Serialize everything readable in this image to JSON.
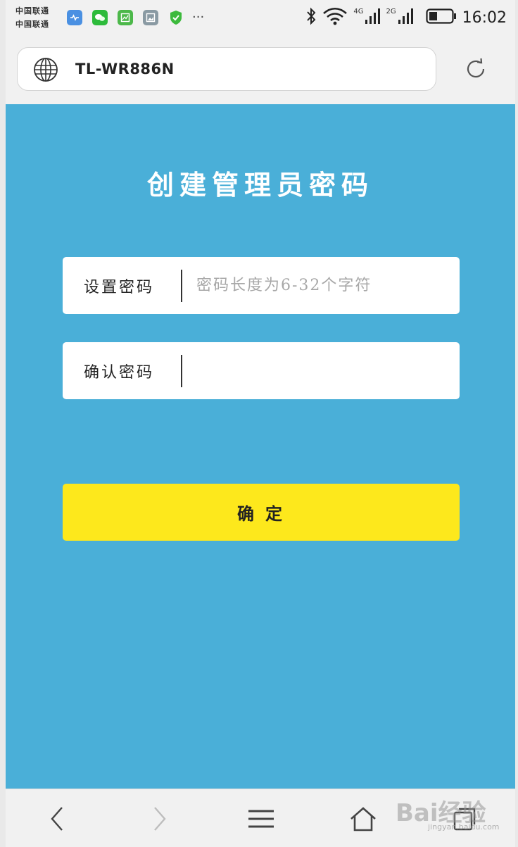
{
  "status_bar": {
    "carrier_1": "中国联通",
    "carrier_2": "中国联通",
    "more": "···",
    "net1": "4G",
    "net2": "2G",
    "time": "16:02"
  },
  "browser": {
    "address": "TL-WR886N"
  },
  "page": {
    "title": "创建管理员密码",
    "password_label": "设置密码",
    "password_placeholder": "密码长度为6-32个字符",
    "confirm_label": "确认密码",
    "confirm_placeholder": "",
    "submit_label": "确定"
  },
  "watermark": {
    "text": "Bai经验",
    "url": "jingyan.baidu.com"
  },
  "colors": {
    "page_bg": "#4aafd8",
    "button_bg": "#fde81c"
  }
}
